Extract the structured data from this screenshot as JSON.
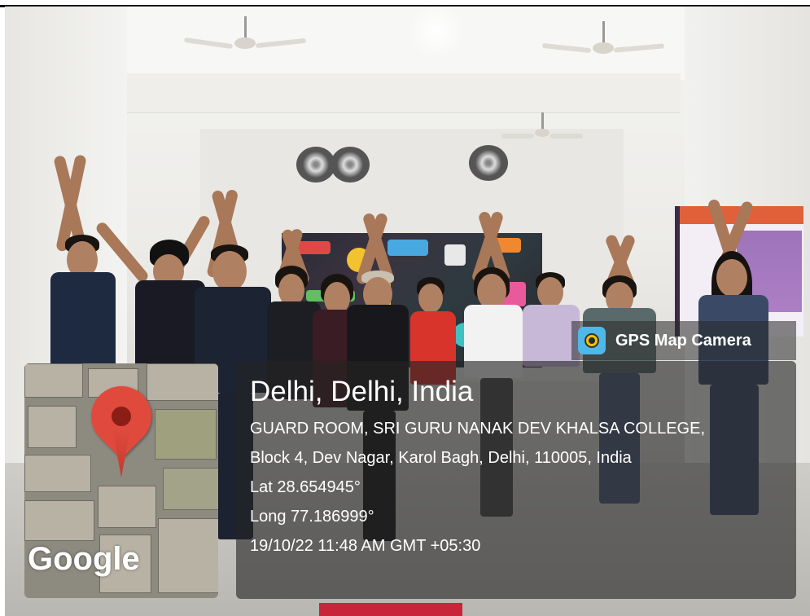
{
  "overlay": {
    "app_name": "GPS Map Camera",
    "location_title": "Delhi, Delhi, India",
    "address_line_1": "GUARD ROOM, SRI GURU NANAK DEV KHALSA COLLEGE,",
    "address_line_2": "Block 4, Dev Nagar, Karol Bagh, Delhi, 110005, India",
    "latitude": "Lat 28.654945°",
    "longitude": "Long 77.186999°",
    "timestamp": "19/10/22 11:48 AM GMT +05:30"
  },
  "map": {
    "provider_label": "Google",
    "pin_color": "#e04a3c"
  },
  "scene": {
    "icons": [
      "ceiling-fan-icon",
      "exhaust-fan-icon",
      "map-pin-icon",
      "camera-app-icon"
    ]
  }
}
